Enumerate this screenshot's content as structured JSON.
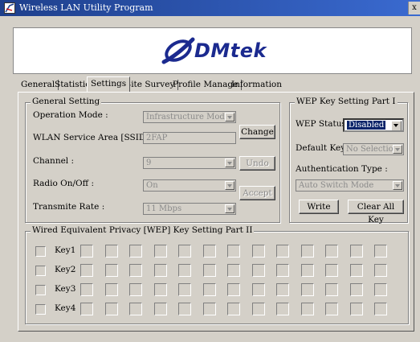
{
  "window": {
    "title": "Wireless LAN Utility Program",
    "close_glyph": "x",
    "title_icon": "wireless-app-icon"
  },
  "banner": {
    "logo_text": "DMtek",
    "logo_mark": "admtek-swoosh-logo",
    "logo_color": "#1b2a8f"
  },
  "tabs": [
    {
      "label": "General"
    },
    {
      "label": "Statistics"
    },
    {
      "label": "Settings"
    },
    {
      "label": "Site Survey"
    },
    {
      "label": "Profile Manage"
    },
    {
      "label": "Information"
    }
  ],
  "active_tab": "Settings",
  "general": {
    "title": "General Setting",
    "operation_mode": {
      "label": "Operation Mode :",
      "value": "Infrastructure Mode"
    },
    "ssid": {
      "label": "WLAN Service Area [SSID] :",
      "value": "2FAP"
    },
    "channel": {
      "label": "Channel :",
      "value": "9"
    },
    "radio": {
      "label": "Radio On/Off :",
      "value": "On"
    },
    "rate": {
      "label": "Transmite Rate :",
      "value": "11 Mbps"
    },
    "change_label": "Change",
    "undo_label": "Undo",
    "accept_label": "Accept"
  },
  "wep1": {
    "title": "WEP Key Setting Part I",
    "status": {
      "label": "WEP Status :",
      "value": "Disabled"
    },
    "default_key": {
      "label": "Default Key :",
      "value": "No Selection"
    },
    "auth": {
      "label": "Authentication Type :",
      "value": "Auto Switch Mode"
    },
    "write_label": "Write",
    "clear_label": "Clear All Key"
  },
  "wep2": {
    "title": "Wired Equivalent Privacy [WEP] Key Setting Part II",
    "keys": [
      {
        "label": "Key1"
      },
      {
        "label": "Key2"
      },
      {
        "label": "Key3"
      },
      {
        "label": "Key4"
      }
    ],
    "boxes_per_key": 13
  }
}
